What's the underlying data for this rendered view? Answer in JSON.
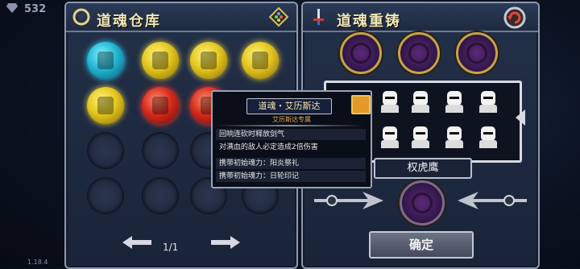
{
  "top_bar": {
    "gem_count": "532",
    "gem_icon": "diamond-icon"
  },
  "version": "1.18.4",
  "storage_panel": {
    "title": "道魂仓库",
    "header_icon": "orb-emblem-icon",
    "filter_icon": "dice-icon",
    "page_indicator": "1/1",
    "prev_icon": "arrow-left-icon",
    "next_icon": "arrow-right-icon"
  },
  "reforge_panel": {
    "title": "道魂重铸",
    "header_icon": "sword-icon",
    "back_icon": "return-icon",
    "selected_name": "权虎鹰",
    "confirm_label": "确定",
    "collapse_icon": "chevron-left-icon"
  },
  "tooltip": {
    "title": "道魂・艾历斯达",
    "subtitle": "艾历斯达专属",
    "lines": [
      "回响连砍时释放剑气",
      "对满血的敌人必定造成2倍伤害",
      "携带初始魂力：阳炎祭礼",
      "携带初始魂力：日轮印记"
    ],
    "icon": "gear-badge-icon"
  },
  "colors": {
    "accent_gold": "#c5a24a",
    "panel_border": "#8f98ad",
    "title_text": "#f0e6b8"
  }
}
